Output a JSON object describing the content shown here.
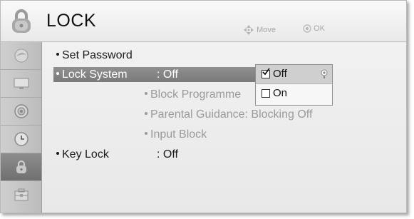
{
  "header": {
    "title": "LOCK",
    "hint_move": "Move",
    "hint_ok": "OK"
  },
  "sidebar": {
    "items": [
      {
        "icon": "picture-icon"
      },
      {
        "icon": "screen-icon"
      },
      {
        "icon": "audio-icon"
      },
      {
        "icon": "clock-icon"
      },
      {
        "icon": "lock-icon",
        "active": true
      },
      {
        "icon": "option-icon"
      }
    ]
  },
  "menu": {
    "set_password": "Set Password",
    "lock_system": "Lock System",
    "lock_system_value": ": Off",
    "block_programme": "Block Programme",
    "parental_guidance": "Parental Guidance: Blocking Off",
    "input_block": "Input Block",
    "key_lock": "Key Lock",
    "key_lock_value": ": Off"
  },
  "popup": {
    "options": [
      {
        "label": "Off",
        "checked": true
      },
      {
        "label": "On",
        "checked": false
      }
    ]
  },
  "colors": {
    "highlight": "#858585",
    "panel": "#ececec",
    "sidebar": "#c4c4c4"
  }
}
